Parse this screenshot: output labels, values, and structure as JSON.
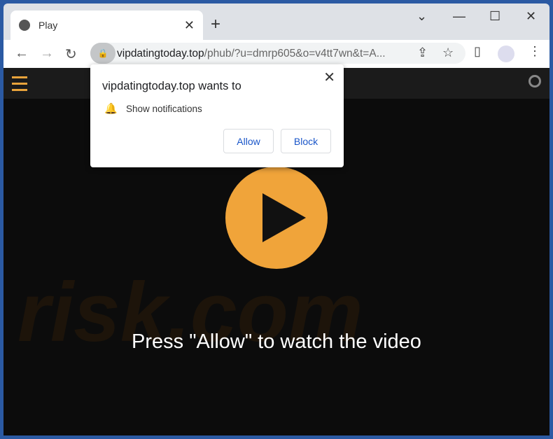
{
  "tab": {
    "title": "Play",
    "icon": "globe-icon"
  },
  "address": {
    "domain": "vipdatingtoday.top",
    "path": "/phub/?u=dmrp605&o=v4tt7wn&t=A..."
  },
  "popup": {
    "title": "vipdatingtoday.top wants to",
    "permission": "Show notifications",
    "allow": "Allow",
    "block": "Block"
  },
  "page": {
    "message": "Press \"Allow\" to watch the video",
    "accent": "#f0a43a"
  }
}
